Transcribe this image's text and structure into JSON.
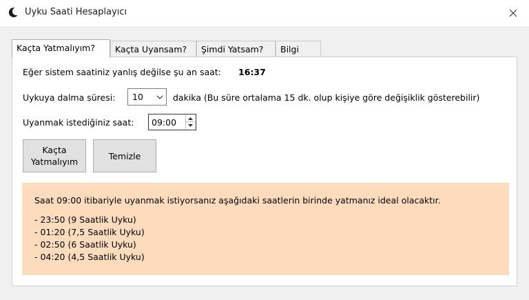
{
  "window": {
    "title": "Uyku Saati Hesaplayıcı",
    "app_icon": "moon-icon",
    "close_icon": "close-icon"
  },
  "tabs": [
    {
      "label": "Kaçta Yatmalıyım?",
      "active": true
    },
    {
      "label": "Kaçta Uyansam?",
      "active": false
    },
    {
      "label": "Şimdi Yatsam?",
      "active": false
    },
    {
      "label": "Bilgi",
      "active": false
    }
  ],
  "current_time": {
    "label": "Eğer sistem saatiniz yanlış değilse şu an saat:",
    "value": "16:37"
  },
  "sleep_latency": {
    "label": "Uykuya dalma süresi:",
    "selected": "10",
    "note": "dakika (Bu süre ortalama 15 dk. olup kişiye göre değişiklik gösterebilir)"
  },
  "wake_time": {
    "label": "Uyanmak istediğiniz saat:",
    "value": "09:00"
  },
  "buttons": {
    "calculate": "Kaçta\nYatmalıyım",
    "clear": "Temizle"
  },
  "result": {
    "intro": "Saat 09:00 itibariyle uyanmak istiyorsanız aşağıdaki saatlerin birinde yatmanız ideal olacaktır.",
    "items": [
      "- 23:50 (9 Saatlik Uyku)",
      "- 01:20 (7,5 Saatlik Uyku)",
      "- 02:50 (6 Saatlik Uyku)",
      "- 04:20 (4,5 Saatlik Uyku)"
    ],
    "background": "#fddcbe"
  }
}
